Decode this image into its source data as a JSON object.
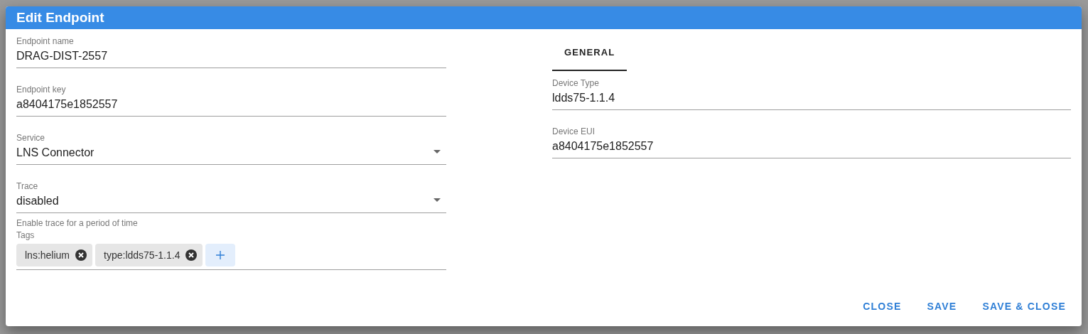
{
  "dialog": {
    "title": "Edit Endpoint"
  },
  "left_fields": [
    {
      "kind": "text",
      "label": "Endpoint name",
      "value": "DRAG-DIST-2557"
    },
    {
      "kind": "text",
      "label": "Endpoint key",
      "value": "a8404175e1852557"
    },
    {
      "kind": "select",
      "label": "Service",
      "value": "LNS Connector"
    },
    {
      "kind": "select",
      "label": "Trace",
      "value": "disabled",
      "hint": "Enable trace for a period of time"
    }
  ],
  "tags": {
    "label": "Tags",
    "chips": [
      "lns:helium",
      "type:ldds75-1.1.4"
    ]
  },
  "tabs": [
    {
      "label": "GENERAL",
      "selected": true
    }
  ],
  "right_fields": [
    {
      "label": "Device Type",
      "value": "ldds75-1.1.4"
    },
    {
      "label": "Device EUI",
      "value": "a8404175e1852557"
    }
  ],
  "buttons": [
    "CLOSE",
    "SAVE",
    "SAVE & CLOSE"
  ]
}
